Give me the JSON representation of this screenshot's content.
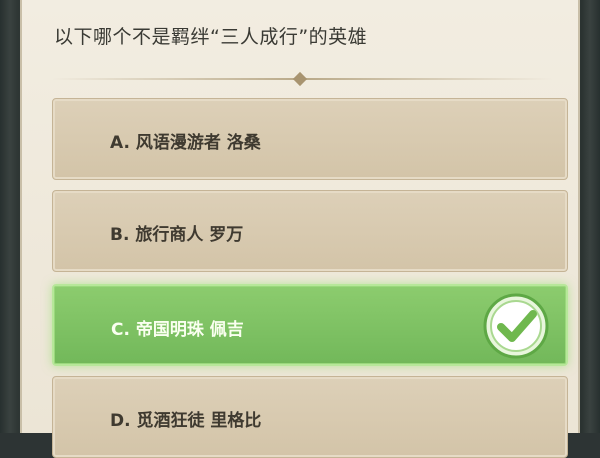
{
  "question": {
    "text": "以下哪个不是羁绊“三人成行”的英雄"
  },
  "options": [
    {
      "label": "A. 风语漫游者 洛桑",
      "state": "default"
    },
    {
      "label": "B. 旅行商人 罗万",
      "state": "default"
    },
    {
      "label": "C. 帝国明珠 佩吉",
      "state": "correct"
    },
    {
      "label": "D. 觅酒狂徒 里格比",
      "state": "default"
    }
  ],
  "colors": {
    "panel": "#ece5d6",
    "option": "#d3c4a8",
    "correct": "#7cc062",
    "check": "#6fb84e"
  },
  "icons": {
    "correct": "checkmark-icon"
  }
}
